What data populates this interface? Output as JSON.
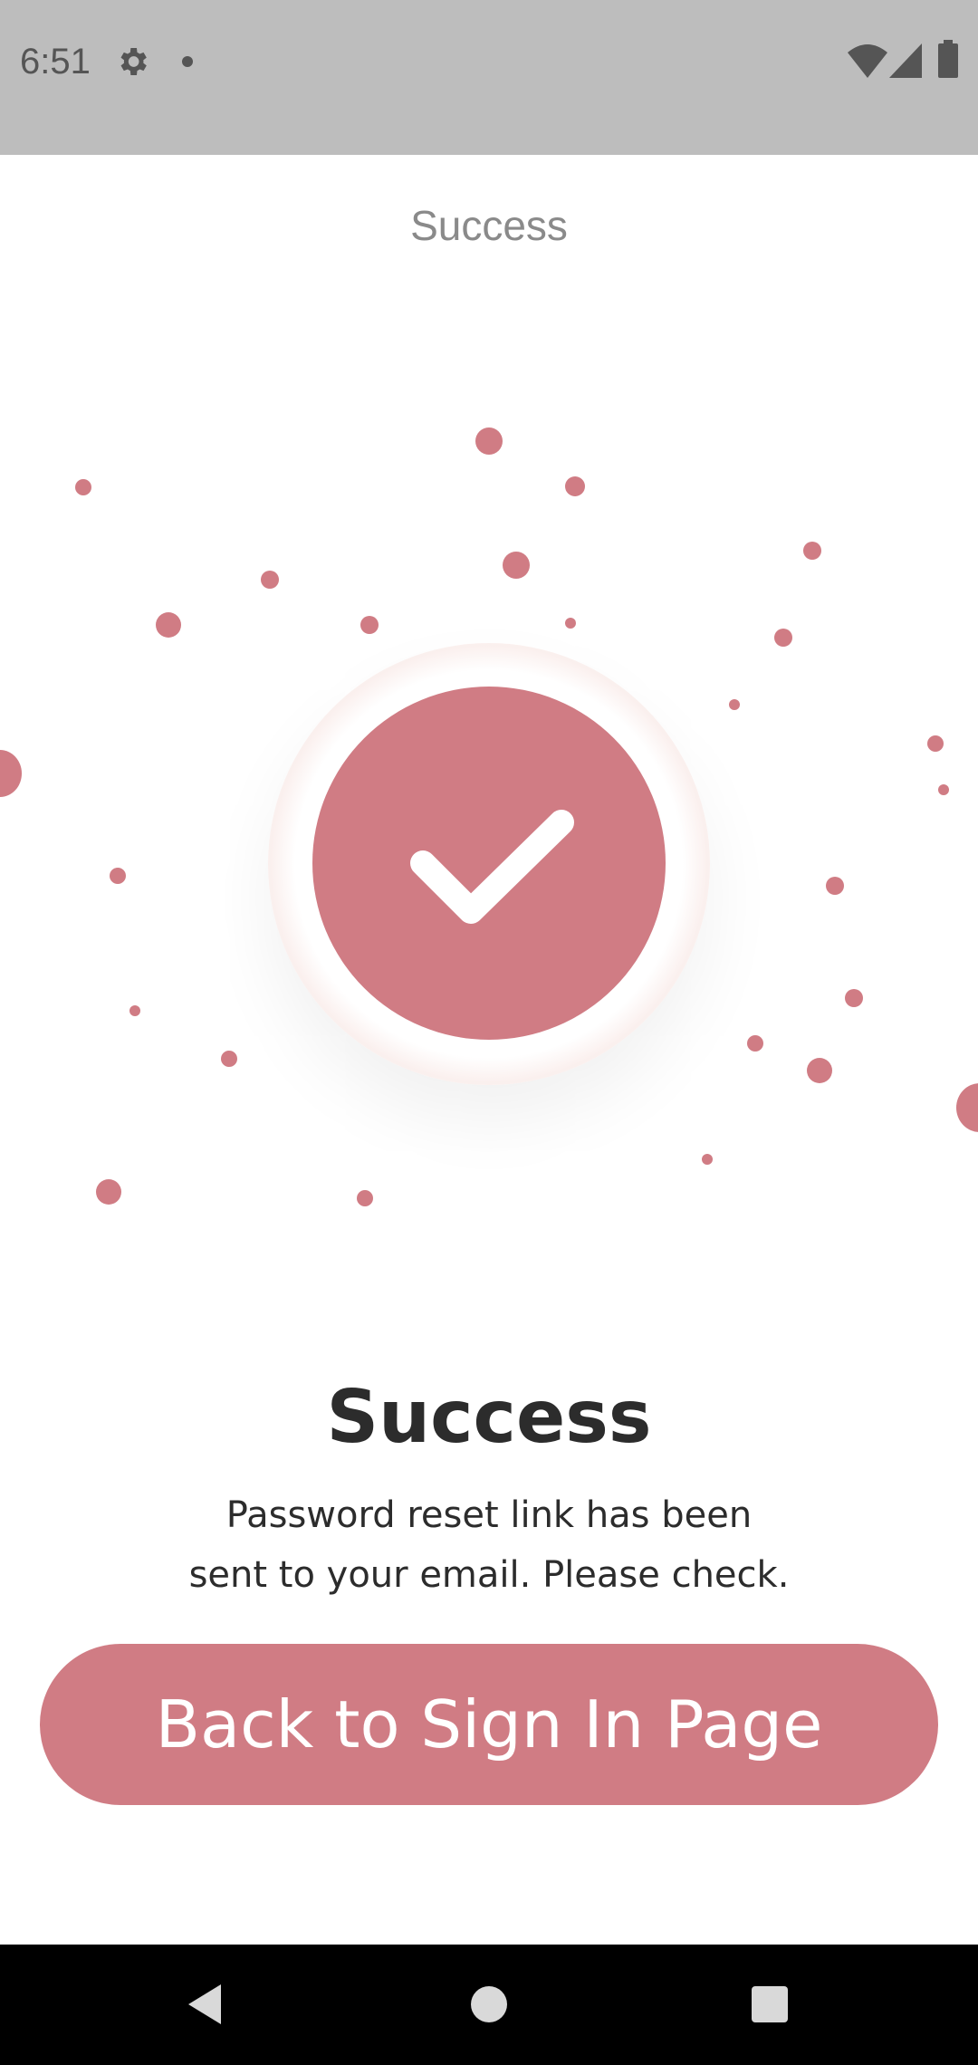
{
  "status_bar": {
    "time": "6:51",
    "icons": [
      "gear-icon",
      "notification-dot-icon",
      "wifi-icon",
      "signal-icon",
      "battery-icon"
    ]
  },
  "header": {
    "title": "Success"
  },
  "illustration": {
    "icon": "check-icon",
    "accent_color": "#d07c84"
  },
  "content": {
    "heading": "Success",
    "message_line1": "Password reset link has been",
    "message_line2": "sent to your email. Please check."
  },
  "actions": {
    "back_label": "Back to Sign In Page"
  },
  "nav_bar": {
    "buttons": [
      "back-icon",
      "home-icon",
      "recents-icon"
    ]
  }
}
